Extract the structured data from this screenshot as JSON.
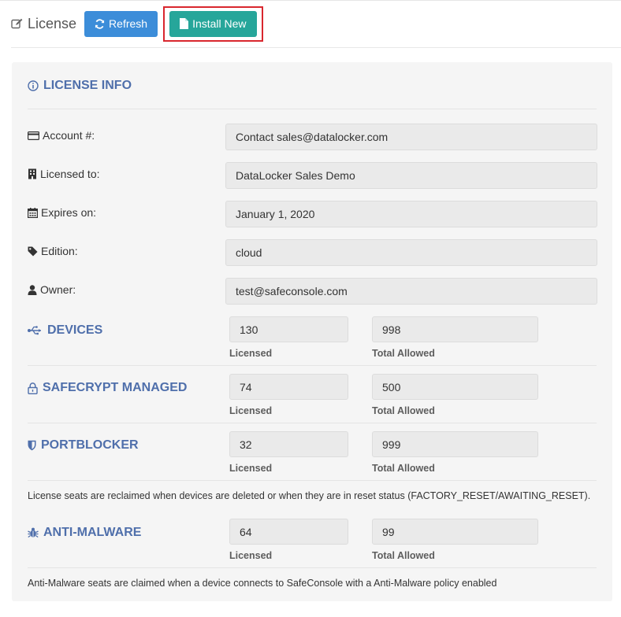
{
  "header": {
    "title": "License",
    "refresh_label": "Refresh",
    "install_label": "Install New"
  },
  "license_info": {
    "heading": "LICENSE INFO",
    "rows": [
      {
        "label": "Account #:",
        "value": "Contact sales@datalocker.com",
        "icon": "credit-card-icon"
      },
      {
        "label": "Licensed to:",
        "value": "DataLocker Sales Demo",
        "icon": "building-icon"
      },
      {
        "label": "Expires on:",
        "value": "January 1, 2020",
        "icon": "calendar-icon"
      },
      {
        "label": "Edition:",
        "value": "cloud",
        "icon": "tag-icon"
      },
      {
        "label": "Owner:",
        "value": "test@safeconsole.com",
        "icon": "user-icon"
      }
    ]
  },
  "seats": [
    {
      "name": "DEVICES",
      "icon": "usb-icon",
      "licensed": "130",
      "total": "998"
    },
    {
      "name": "SAFECRYPT MANAGED",
      "icon": "lock-icon",
      "licensed": "74",
      "total": "500"
    },
    {
      "name": "PORTBLOCKER",
      "icon": "shield-icon",
      "licensed": "32",
      "total": "999"
    }
  ],
  "seat_labels": {
    "licensed": "Licensed",
    "total": "Total Allowed"
  },
  "seats_note": "License seats are reclaimed when devices are deleted or when they are in reset status (FACTORY_RESET/AWAITING_RESET).",
  "anti_malware": {
    "name": "ANTI-MALWARE",
    "icon": "bug-icon",
    "licensed": "64",
    "total": "99",
    "note": "Anti-Malware seats are claimed when a device connects to SafeConsole with a Anti-Malware policy enabled"
  },
  "colors": {
    "accent": "#4f6fab",
    "refresh_button": "#3c8dd9",
    "install_button": "#26a69a",
    "highlight_border": "#d9272e"
  }
}
